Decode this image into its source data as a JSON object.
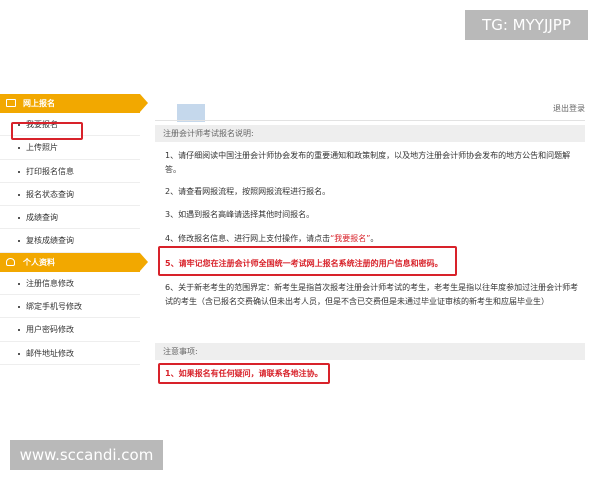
{
  "watermarks": {
    "top": "TG: MYYJJPP",
    "bottom": "www.sccandi.com"
  },
  "sidebar": {
    "section1": {
      "title": "网上报名",
      "items": [
        {
          "label": "我要报名"
        },
        {
          "label": "上传照片"
        },
        {
          "label": "打印报名信息"
        },
        {
          "label": "报名状态查询"
        },
        {
          "label": "成绩查询"
        },
        {
          "label": "复核成绩查询"
        }
      ]
    },
    "section2": {
      "title": "个人资料",
      "items": [
        {
          "label": "注册信息修改"
        },
        {
          "label": "绑定手机号修改"
        },
        {
          "label": "用户密码修改"
        },
        {
          "label": "邮件地址修改"
        }
      ]
    }
  },
  "header": {
    "logout": "退出登录"
  },
  "main": {
    "intro_title": "注册会计师考试报名说明:",
    "instructions": {
      "p1": "1、请仔细阅读中国注册会计师协会发布的重要通知和政策制度，以及地方注册会计师协会发布的地方公告和问题解答。",
      "p2": "2、请查看网报流程，按照网报流程进行报名。",
      "p3": "3、如遇到报名高峰请选择其他时间报名。",
      "p4_prefix": "4、修改报名信息、进行网上支付操作，请点击",
      "p4_link": "“我要报名”",
      "p4_suffix": "。",
      "p5": "5、请牢记您在注册会计师全国统一考试网上报名系统注册的用户信息和密码。",
      "p6": "6、关于新老考生的范围界定：新考生是指首次报考注册会计师考试的考生，老考生是指以往年度参加过注册会计师考试的考生（含已报名交费确认但未出考人员，但是不含已交费但是未通过毕业证审核的新考生和应届毕业生）"
    },
    "notice_title": "注意事项:",
    "notice_1": "1、如果报名有任何疑问，请联系各地注协。"
  },
  "colors": {
    "accent": "#f2a800",
    "highlight": "#d8222a"
  }
}
